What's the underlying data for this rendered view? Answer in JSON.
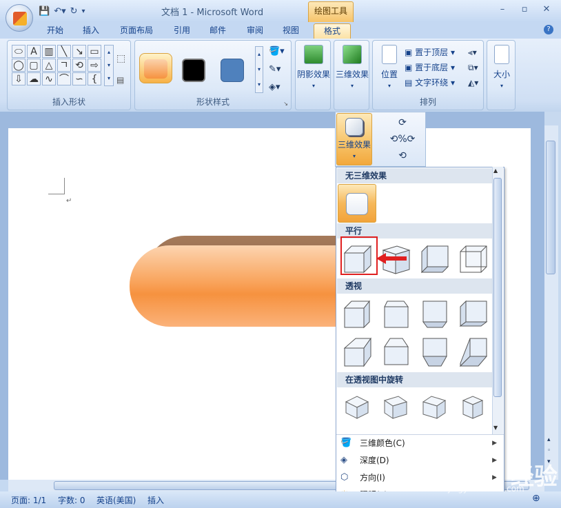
{
  "window": {
    "title": "文档 1 - Microsoft Word",
    "tool_context": "绘图工具"
  },
  "tabs": [
    "开始",
    "插入",
    "页面布局",
    "引用",
    "邮件",
    "审阅",
    "视图"
  ],
  "active_tab": "格式",
  "groups": {
    "insert_shapes": "插入形状",
    "shape_styles": "形状样式",
    "shadow_effects": "阴影效果",
    "three_d_effects": "三维效果",
    "arrange": "排列",
    "size": "大小",
    "position": "位置"
  },
  "arrange_items": [
    "置于顶层",
    "置于底层",
    "文字环绕"
  ],
  "fx3d_button": "三维效果",
  "dropdown": {
    "sections": [
      "无三维效果",
      "平行",
      "透视",
      "在透视图中旋转"
    ],
    "menu": [
      {
        "label": "三维颜色(C)",
        "icon": "paint-bucket-icon"
      },
      {
        "label": "深度(D)",
        "icon": "depth-icon"
      },
      {
        "label": "方向(I)",
        "icon": "direction-icon"
      },
      {
        "label": "照明(L)",
        "icon": "lighting-icon"
      }
    ]
  },
  "status": {
    "page": "页面: 1/1",
    "words": "字数: 0",
    "lang": "英语(美国)",
    "mode": "插入"
  },
  "watermark": {
    "brand": "Baidu 经验",
    "url": "jingyan.baidu.com"
  },
  "colors": {
    "accent": "#f6923f",
    "highlight": "#e02020",
    "ribbon": "#dde9f8"
  }
}
